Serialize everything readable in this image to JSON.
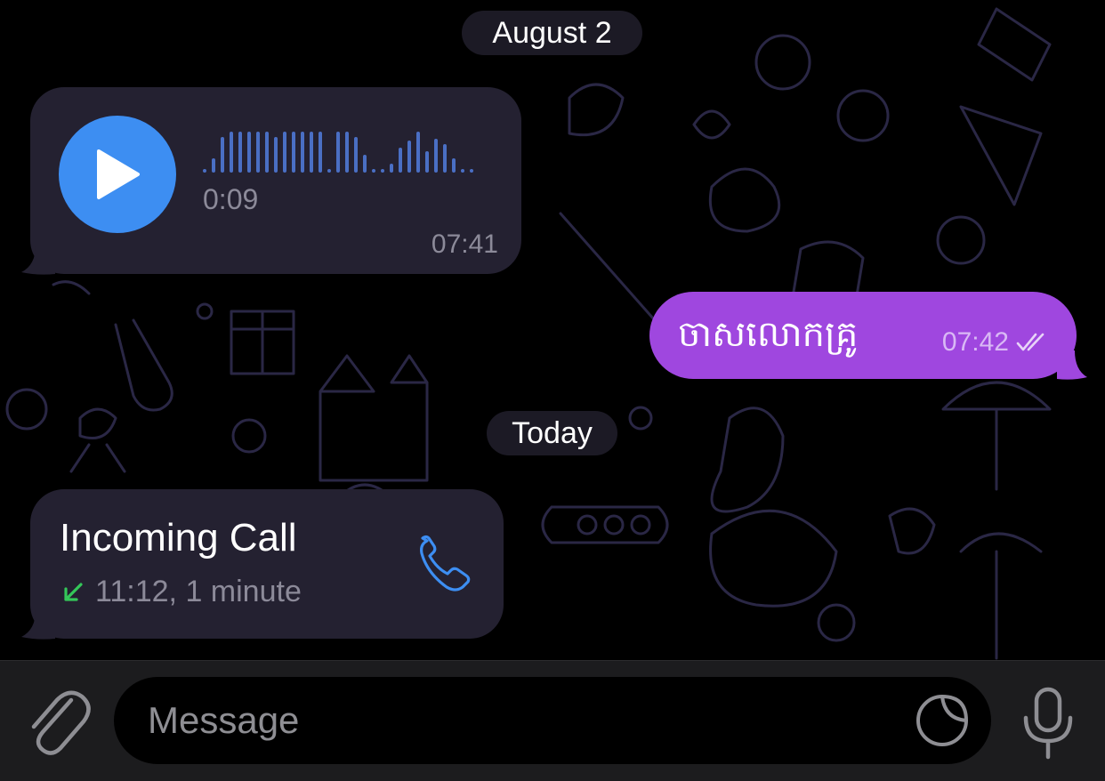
{
  "chat": {
    "date_pills": {
      "first": "August 2",
      "second": "Today"
    },
    "voice_message": {
      "duration": "0:09",
      "time": "07:41"
    },
    "outgoing_message": {
      "text": "ចាសលោកគ្រូ",
      "time": "07:42",
      "status": "read-double-check"
    },
    "call_message": {
      "title": "Incoming Call",
      "details": "11:12, 1 minute",
      "direction_icon": "incoming-arrow-icon"
    }
  },
  "input_bar": {
    "placeholder": "Message"
  },
  "colors": {
    "background": "#000000",
    "incoming_bubble": "#242131",
    "outgoing_bubble": "#9f47df",
    "accent_blue": "#3d8ef2",
    "call_arrow_green": "#34c759",
    "input_bar": "#1c1c1e"
  }
}
